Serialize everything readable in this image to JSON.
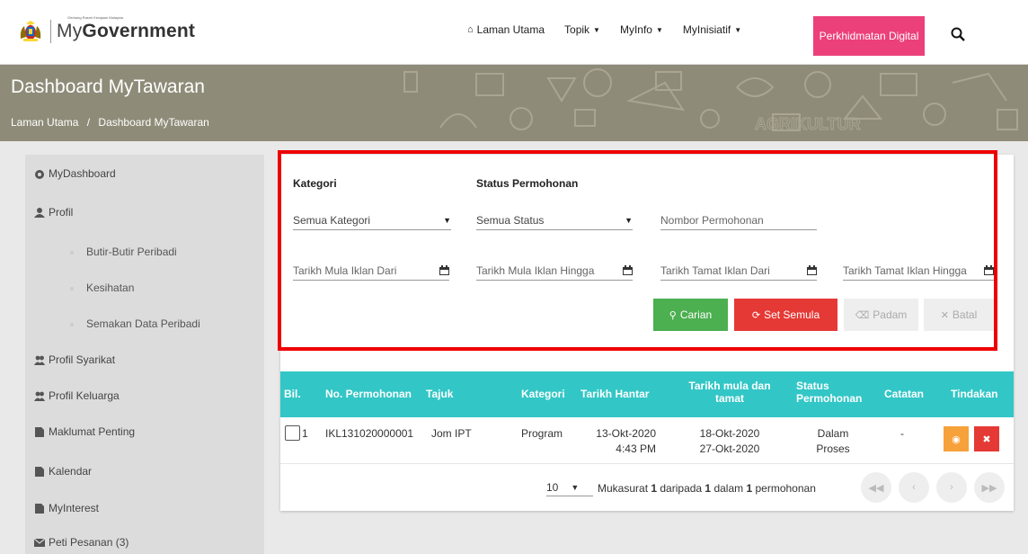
{
  "header": {
    "logo_tagline": "Gerbang Rasmi Kerajaan Malaysia",
    "logo_prefix": "My",
    "logo_bold": "Government",
    "nav": [
      {
        "label": "Laman Utama",
        "icon": "home-icon"
      },
      {
        "label": "Topik",
        "icon": "caret-down-icon"
      },
      {
        "label": "MyInfo",
        "icon": "caret-down-icon"
      },
      {
        "label": "MyInisiatif",
        "icon": "caret-down-icon"
      }
    ],
    "digital_button": "Perkhidmatan Digital",
    "accent_color": "#ec407a"
  },
  "hero": {
    "title": "Dashboard MyTawaran",
    "breadcrumb": [
      "Laman Utama",
      "/",
      "Dashboard MyTawaran"
    ],
    "background_color": "#8e8b78"
  },
  "sidebar": {
    "items": [
      {
        "label": "MyDashboard",
        "icon": "dashboard-icon"
      },
      {
        "label": "Profil",
        "icon": "user-icon"
      },
      {
        "label": "Butir-Butir Peribadi",
        "sub": true
      },
      {
        "label": "Kesihatan",
        "sub": true
      },
      {
        "label": "Semakan Data Peribadi",
        "sub": true
      },
      {
        "label": "Profil Syarikat",
        "icon": "users-icon"
      },
      {
        "label": "Profil Keluarga",
        "icon": "users-icon"
      },
      {
        "label": "Maklumat Penting",
        "icon": "file-icon"
      },
      {
        "label": "Kalendar",
        "icon": "file-icon"
      },
      {
        "label": "MyInterest",
        "icon": "file-icon"
      },
      {
        "label": "Peti Pesanan (3)",
        "icon": "envelope-icon"
      }
    ]
  },
  "filters": {
    "kategori_label": "Kategori",
    "kategori_value": "Semua Kategori",
    "status_label": "Status Permohonan",
    "status_value": "Semua Status",
    "nombor_placeholder": "Nombor Permohonan",
    "mula_dari_placeholder": "Tarikh Mula Iklan Dari",
    "mula_hingga_placeholder": "Tarikh Mula Iklan Hingga",
    "tamat_dari_placeholder": "Tarikh Tamat Iklan Dari",
    "tamat_hingga_placeholder": "Tarikh Tamat Iklan Hingga",
    "buttons": {
      "cari": "Carian",
      "set": "Set Semula",
      "padam": "Padam",
      "batal": "Batal"
    }
  },
  "table": {
    "headers": [
      "Bil.",
      "No. Permohonan",
      "Tajuk",
      "Kategori",
      "Tarikh Hantar",
      "Tarikh mula dan tamat",
      "Status Permohonan",
      "Catatan",
      "Tindakan"
    ],
    "header_color": "#33c6c6",
    "rows": [
      {
        "bil": "1",
        "no": "IKL131020000001",
        "tajuk": "Jom IPT",
        "kategori": "Program",
        "hantar_date": "13-Okt-2020",
        "hantar_time": "4:43 PM",
        "mula": "18-Okt-2020",
        "tamat": "27-Okt-2020",
        "status_1": "Dalam",
        "status_2": "Proses",
        "catatan": "-"
      }
    ]
  },
  "pagination": {
    "page_size": "10",
    "info_prefix": "Mukasurat ",
    "info_page": "1",
    "info_mid": " daripada ",
    "info_total_pages": "1",
    "info_mid2": " dalam ",
    "info_count": "1",
    "info_suffix": " permohonan"
  }
}
